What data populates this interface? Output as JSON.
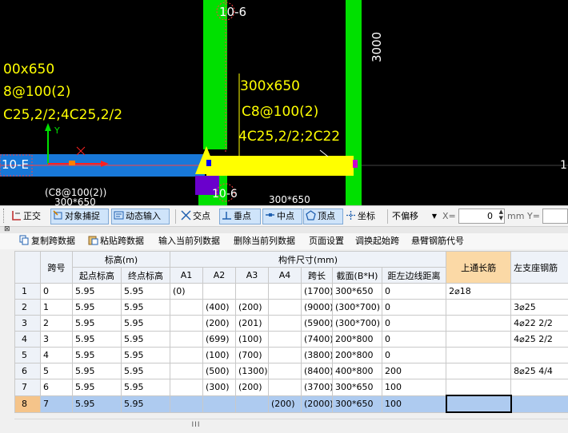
{
  "cad": {
    "labels": {
      "axis_10_6_top": "10-6",
      "axis_10_6_mid": "10-6",
      "axis_10_e": "10-E",
      "dim_3000": "3000",
      "beam1_size": "00x650",
      "beam1_stirrup": "8@100(2)",
      "beam1_rebar": "C25,2/2;4C25,2/2",
      "beam2_size": "300x650",
      "beam2_stirrup": "C8@100(2)",
      "beam2_rebar": "4C25,2/2;2C22",
      "beam3_stirrup": "(C8@100(2))",
      "beam3_size": "300*650",
      "beam4_size": "300*650",
      "axis_y": "Y",
      "axis_x": "X",
      "right_edge": "1"
    },
    "colors": {
      "background": "#000000",
      "column": "#00e000",
      "beam_selected": "#ffff00",
      "beam_blue": "#1878d8",
      "annotation": "#ffff00",
      "magenta": "#cc00cc",
      "purple": "#6a00cc"
    }
  },
  "snap_toolbar": {
    "items": [
      {
        "name": "ortho",
        "label": "正交",
        "icon": "ortho-icon",
        "active": false
      },
      {
        "name": "object-snap",
        "label": "对象捕捉",
        "icon": "object-snap-icon",
        "active": true
      },
      {
        "name": "dynamic-input",
        "label": "动态输入",
        "icon": "dynamic-input-icon",
        "active": true
      },
      {
        "name": "intersection",
        "label": "交点",
        "icon": "intersection-icon",
        "active": false
      },
      {
        "name": "perpendicular",
        "label": "垂点",
        "icon": "perpendicular-icon",
        "active": true
      },
      {
        "name": "midpoint",
        "label": "中点",
        "icon": "midpoint-icon",
        "active": true
      },
      {
        "name": "vertex",
        "label": "顶点",
        "icon": "vertex-icon",
        "active": true
      },
      {
        "name": "coordinate",
        "label": "坐标",
        "icon": "coordinate-icon",
        "active": false
      }
    ],
    "offset_select": "不偏移",
    "x_label": "X=",
    "x_value": "0",
    "unit": "mm",
    "y_label": "Y="
  },
  "command_bar": {
    "items": [
      {
        "name": "copy-span-data",
        "label": "复制跨数据",
        "icon": "copy-icon"
      },
      {
        "name": "paste-span-data",
        "label": "粘贴跨数据",
        "icon": "paste-icon"
      },
      {
        "name": "input-current-column",
        "label": "输入当前列数据"
      },
      {
        "name": "delete-current-column",
        "label": "删除当前列数据"
      },
      {
        "name": "page-setup",
        "label": "页面设置"
      },
      {
        "name": "swap-start-span",
        "label": "调换起始跨"
      },
      {
        "name": "cantilever-rebar-code",
        "label": "悬臂钢筋代号"
      }
    ]
  },
  "table": {
    "group_headers": {
      "span": "跨号",
      "elevation": "标高(m)",
      "dimension": "构件尺寸(mm)",
      "top_long_bar": "上通长筋",
      "left_support_bar": "左支座钢筋"
    },
    "columns": {
      "start_elev": "起点标高",
      "end_elev": "终点标高",
      "a1": "A1",
      "a2": "A2",
      "a3": "A3",
      "a4": "A4",
      "span_len": "跨长",
      "section": "截面(B*H)",
      "left_edge_dist": "距左边线距离"
    },
    "rows": [
      {
        "num": "1",
        "span": "0",
        "start": "5.95",
        "end": "5.95",
        "a1": "(0)",
        "a2": "",
        "a3": "",
        "a4": "",
        "len": "(1700)",
        "section": "300*650",
        "dist": "0",
        "top": "2⌀18",
        "left": ""
      },
      {
        "num": "2",
        "span": "1",
        "start": "5.95",
        "end": "5.95",
        "a1": "",
        "a2": "(400)",
        "a3": "(200)",
        "a4": "",
        "len": "(9000)",
        "section": "(300*700)",
        "dist": "0",
        "top": "",
        "left": "3⌀25"
      },
      {
        "num": "3",
        "span": "2",
        "start": "5.95",
        "end": "5.95",
        "a1": "",
        "a2": "(200)",
        "a3": "(201)",
        "a4": "",
        "len": "(5900)",
        "section": "(300*700)",
        "dist": "0",
        "top": "",
        "left": "4⌀22 2/2"
      },
      {
        "num": "4",
        "span": "3",
        "start": "5.95",
        "end": "5.95",
        "a1": "",
        "a2": "(699)",
        "a3": "(100)",
        "a4": "",
        "len": "(7400)",
        "section": "200*800",
        "dist": "0",
        "top": "",
        "left": "4⌀25 2/2"
      },
      {
        "num": "5",
        "span": "4",
        "start": "5.95",
        "end": "5.95",
        "a1": "",
        "a2": "(100)",
        "a3": "(700)",
        "a4": "",
        "len": "(3800)",
        "section": "200*800",
        "dist": "0",
        "top": "",
        "left": ""
      },
      {
        "num": "6",
        "span": "5",
        "start": "5.95",
        "end": "5.95",
        "a1": "",
        "a2": "(500)",
        "a3": "(1300)",
        "a4": "",
        "len": "(8400)",
        "section": "400*800",
        "dist": "200",
        "top": "",
        "left": "8⌀25 4/4"
      },
      {
        "num": "7",
        "span": "6",
        "start": "5.95",
        "end": "5.95",
        "a1": "",
        "a2": "(300)",
        "a3": "(200)",
        "a4": "",
        "len": "(3700)",
        "section": "300*650",
        "dist": "100",
        "top": "",
        "left": ""
      },
      {
        "num": "8",
        "span": "7",
        "start": "5.95",
        "end": "5.95",
        "a1": "",
        "a2": "",
        "a3": "",
        "a4": "(200)",
        "len": "(2000)",
        "section": "300*650",
        "dist": "100",
        "top": "",
        "left": "",
        "selected": true
      }
    ]
  },
  "scrollbar": {
    "thumb_grip": "III"
  }
}
